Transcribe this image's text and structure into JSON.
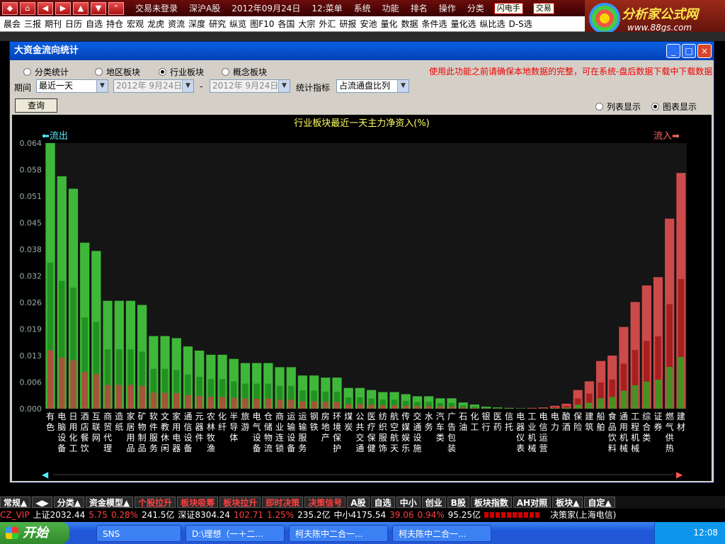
{
  "top": {
    "nav": [
      "◆",
      "⌂",
      "◀",
      "▶",
      "▲",
      "▼",
      "⌃"
    ],
    "menus": [
      "交易未登录",
      "深沪A股",
      "2012年09月24日",
      "12:菜单",
      "系统",
      "功能",
      "排名",
      "操作",
      "分类"
    ],
    "btn1": "闪电手",
    "btn2": "交易"
  },
  "logo": {
    "title": "分析家公式网",
    "url": "www.88gs.com"
  },
  "menubar": [
    "晨会",
    "三报",
    "期刊",
    "日历",
    "自选",
    "持仓",
    "宏观",
    "龙虎",
    "资流",
    "深度",
    "研究",
    "纵览",
    "图F10",
    "各国",
    "大宗",
    "外汇",
    "研报",
    "安池",
    "量化",
    "数据",
    "条件选",
    "量化选",
    "纵比选",
    "D-S选"
  ],
  "window": {
    "title": "大资金流向统计",
    "min": "_",
    "max": "□",
    "close": "×"
  },
  "radios": [
    "分类统计",
    "地区板块",
    "行业板块",
    "概念板块"
  ],
  "period": {
    "label": "期间",
    "value": "最近一天",
    "date1": "2012年 9月24日",
    "dash": "-",
    "date2": "2012年 9月24日"
  },
  "metric": {
    "label": "统计指标",
    "value": "占流通盘比列"
  },
  "warning": "使用此功能之前请确保本地数据的完整，可在系统-盘后数据下载中下载数据",
  "query": "查询",
  "display": {
    "list": "列表显示",
    "chart": "图表显示"
  },
  "chart_data": {
    "type": "bar",
    "title": "行业板块最近一天主力净资入(%)",
    "out_label": "流出",
    "in_label": "流入",
    "ylim": [
      0,
      0.064
    ],
    "yticks": [
      "0.064",
      "0.058",
      "0.051",
      "0.045",
      "0.038",
      "0.032",
      "0.026",
      "0.019",
      "0.013",
      "0.006",
      "0.000"
    ],
    "categories": [
      "有色",
      "电脑设备",
      "日用化工",
      "酒店餐饮",
      "互联网",
      "商贸代理",
      "造纸",
      "家居用品",
      "矿物制品",
      "软件服务",
      "文教休闲",
      "家用电器",
      "通信设备",
      "元器件",
      "农林牧渔",
      "化纤",
      "半导体",
      "旅游",
      "电气设备",
      "仓储物流",
      "商业连锁",
      "运输设备",
      "运输服务",
      "钢铁",
      "房地产",
      "环境保护",
      "煤炭",
      "公共交通",
      "医疗保健",
      "纺织服饰",
      "航空航天",
      "传媒娱乐",
      "交通设施",
      "水务",
      "汽车类",
      "广告包装",
      "石油",
      "化工",
      "银行",
      "医药",
      "信托",
      "电器仪表",
      "工业机械",
      "电信运营",
      "电力",
      "酿酒",
      "保险",
      "建筑",
      "船舶",
      "食品饮料",
      "通用机械",
      "工程机械",
      "综合类",
      "证券",
      "燃气供热",
      "建材"
    ],
    "outflow": [
      0.064,
      0.056,
      0.053,
      0.04,
      0.038,
      0.026,
      0.026,
      0.026,
      0.025,
      0.0175,
      0.0175,
      0.017,
      0.015,
      0.014,
      0.013,
      0.013,
      0.012,
      0.011,
      0.011,
      0.011,
      0.01,
      0.01,
      0.008,
      0.008,
      0.0075,
      0.0075,
      0.005,
      0.005,
      0.0045,
      0.004,
      0.004,
      0.0035,
      0.003,
      0.003,
      0.0025,
      0.0025,
      0.0015,
      0.001,
      0.0005,
      0.0003,
      0.0002,
      0.0001
    ],
    "inflow": [
      0.0002,
      0.0003,
      0.0007,
      0.0012,
      0.0045,
      0.0066,
      0.0115,
      0.0128,
      0.0197,
      0.0257,
      0.0297,
      0.0317,
      0.0458,
      0.0568
    ]
  },
  "bottom_tabs": [
    "常规▲",
    "◀▶",
    "分类▲",
    "资金模型▲",
    "个股拉升",
    "板块吸筹",
    "板块拉升",
    "即时决策",
    "决策信号",
    "A股",
    "自选",
    "中小",
    "创业",
    "B股",
    "板块指数",
    "AH对照",
    "板块▲",
    "自定▲"
  ],
  "ticker": {
    "name": "CZ_VIP",
    "sh": "上证2032.44",
    "sh_chg": "5.75",
    "sh_pct": "0.28%",
    "sh_amt": "241.5亿",
    "sz": "深证8304.24",
    "sz_chg": "102.71",
    "sz_pct": "1.25%",
    "sz_amt": "235.2亿",
    "zx": "中小4175.54",
    "zx_chg": "39.06",
    "zx_pct": "0.94%",
    "zx_amt": "95.25亿",
    "right": "决策家(上海电信)"
  },
  "taskbar": {
    "start": "开始",
    "tasks": [
      "SNS",
      "D:\\理想（一＋二...",
      "柯夫陈中二合一...",
      "柯夫陈中二合一..."
    ],
    "time": "12:08"
  }
}
